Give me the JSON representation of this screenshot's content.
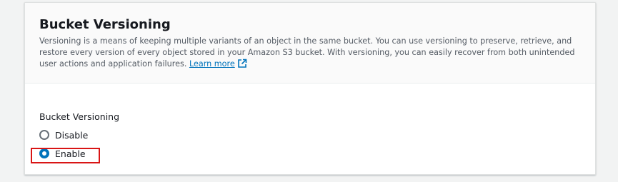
{
  "panel": {
    "title": "Bucket Versioning",
    "description": "Versioning is a means of keeping multiple variants of an object in the same bucket. You can use versioning to preserve, retrieve, and restore every version of every object stored in your Amazon S3 bucket. With versioning, you can easily recover from both unintended user actions and application failures.",
    "learn_more_label": "Learn more",
    "learn_more_icon": "external-link-icon"
  },
  "versioning": {
    "field_label": "Bucket Versioning",
    "options": [
      {
        "label": "Disable",
        "selected": false
      },
      {
        "label": "Enable",
        "selected": true
      }
    ],
    "highlighted_option": "Enable"
  },
  "colors": {
    "page_background": "#f2f3f3",
    "header_background": "#fafafa",
    "link": "#0073bb",
    "radio_selected": "#0073bb",
    "highlight_border": "#d91515",
    "text_primary": "#16191f",
    "text_secondary": "#545b64"
  }
}
